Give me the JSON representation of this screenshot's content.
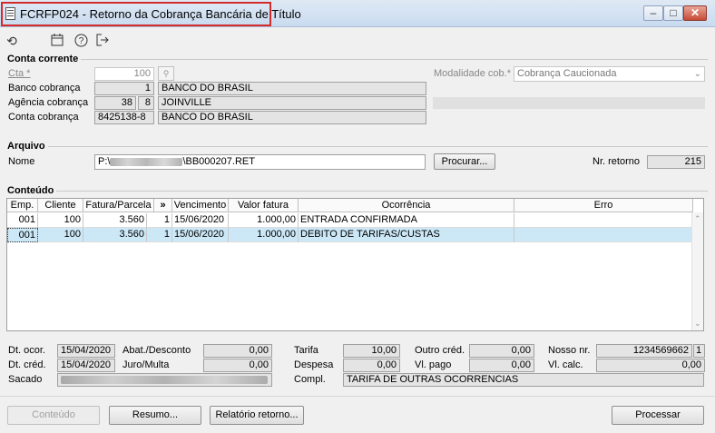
{
  "window": {
    "title": "FCRFP024 - Retorno da Cobrança Bancária de Título",
    "minimize": "–",
    "maximize": "□",
    "close": "✕"
  },
  "toolbar": [
    "undo-icon",
    "calendar-icon",
    "help-icon",
    "exit-icon"
  ],
  "conta_corrente": {
    "section_title": "Conta corrente",
    "cta_label": "Cta *",
    "cta_value": "100",
    "banco_label": "Banco cobrança",
    "banco_code": "1",
    "banco_name": "BANCO DO BRASIL",
    "agencia_label": "Agência cobrança",
    "agencia_code": "38",
    "agencia_digit": "8",
    "agencia_name": "JOINVILLE",
    "conta_label": "Conta cobrança",
    "conta_code": "8425138-8",
    "conta_name": "BANCO DO BRASIL",
    "modalidade_label": "Modalidade cob.*",
    "modalidade_value": "Cobrança Caucionada"
  },
  "arquivo": {
    "section_title": "Arquivo",
    "nome_label": "Nome",
    "nome_prefix": "P:\\",
    "nome_suffix": "\\BB000207.RET",
    "procurar_button": "Procurar...",
    "nr_retorno_label": "Nr. retorno",
    "nr_retorno_value": "215"
  },
  "conteudo": {
    "section_title": "Conteúdo",
    "columns": [
      "Emp.",
      "Cliente",
      "Fatura/Parcela",
      "»",
      "Vencimento",
      "Valor fatura",
      "Ocorrência",
      "Erro"
    ],
    "rows": [
      {
        "emp": "001",
        "cliente": "100",
        "fatura": "3.560",
        "parcela": "1",
        "vencimento": "15/06/2020",
        "valor": "1.000,00",
        "ocorrencia": "ENTRADA CONFIRMADA",
        "erro": ""
      },
      {
        "emp": "001",
        "cliente": "100",
        "fatura": "3.560",
        "parcela": "1",
        "vencimento": "15/06/2020",
        "valor": "1.000,00",
        "ocorrencia": "DEBITO DE TARIFAS/CUSTAS",
        "erro": ""
      }
    ]
  },
  "details": {
    "dt_ocor_label": "Dt. ocor.",
    "dt_ocor_value": "15/04/2020",
    "dt_cred_label": "Dt. créd.",
    "dt_cred_value": "15/04/2020",
    "sacado_label": "Sacado",
    "abat_label": "Abat./Desconto",
    "abat_value": "0,00",
    "juro_label": "Juro/Multa",
    "juro_value": "0,00",
    "tarifa_label": "Tarifa",
    "tarifa_value": "10,00",
    "despesa_label": "Despesa",
    "despesa_value": "0,00",
    "compl_label": "Compl.",
    "compl_value": "TARIFA DE OUTRAS OCORRENCIAS",
    "outro_cred_label": "Outro créd.",
    "outro_cred_value": "0,00",
    "vl_pago_label": "Vl. pago",
    "vl_pago_value": "0,00",
    "nosso_nr_label": "Nosso nr.",
    "nosso_nr_value": "1234569662",
    "nosso_nr_digit": "1",
    "vl_calc_label": "Vl. calc.",
    "vl_calc_value": "0,00"
  },
  "footer": {
    "conteudo_button": "Conteúdo",
    "resumo_button": "Resumo...",
    "relatorio_button": "Relatório retorno...",
    "processar_button": "Processar"
  }
}
